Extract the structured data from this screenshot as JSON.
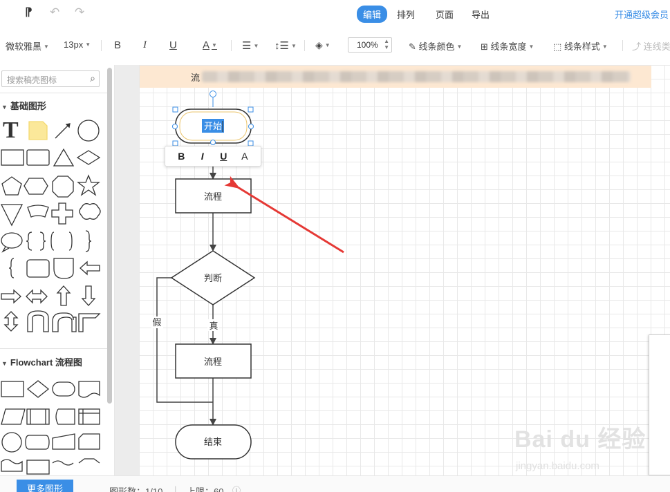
{
  "menu": {
    "tabs": [
      "编辑",
      "排列",
      "页面",
      "导出"
    ],
    "active_tab": "编辑",
    "vip_link": "开通超级会员"
  },
  "format": {
    "font_family": "微软雅黑",
    "font_size": "13px",
    "bold": "B",
    "italic": "I",
    "underline": "U",
    "font_color": "A",
    "zoom": "100%",
    "line_color": "线条颜色",
    "line_width": "线条宽度",
    "line_style": "线条样式",
    "connector": "连线类"
  },
  "sidebar": {
    "search_placeholder": "搜索稿壳图标",
    "section_basic": "基础图形",
    "section_flowchart": "Flowchart 流程图",
    "more_shapes": "更多图形",
    "text_shape_label": "T"
  },
  "canvas": {
    "banner_text": "流",
    "nodes": {
      "start": "开始",
      "process1": "流程",
      "decision": "判断",
      "process2": "流程",
      "end": "结束"
    },
    "edge_labels": {
      "yes": "真",
      "no": "假"
    }
  },
  "text_toolbar": {
    "bold": "B",
    "italic": "I",
    "underline": "U",
    "font": "A"
  },
  "status": {
    "shape_count": "图形数：1/10",
    "limit": "上限：60"
  },
  "watermark": {
    "brand": "Bai du 经验",
    "url": "jingyan.baidu.com"
  },
  "colors": {
    "accent": "#3a8ee6",
    "arrow": "#e53935",
    "banner": "#fde8d2",
    "selection": "#3a8ee6"
  }
}
